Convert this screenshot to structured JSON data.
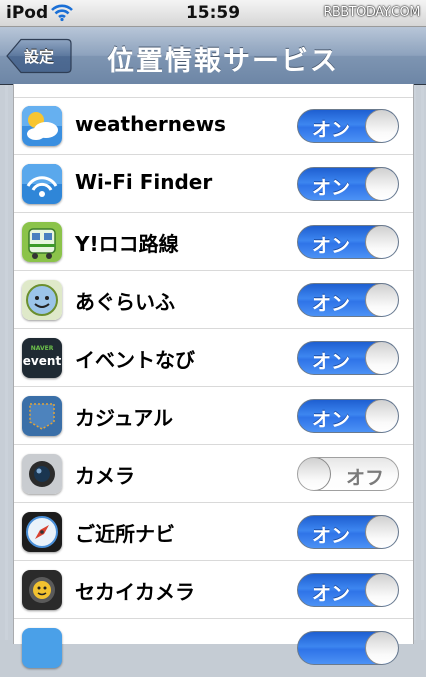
{
  "status": {
    "carrier": "iPod",
    "time": "15:59",
    "watermark": "RBBTODAY.COM"
  },
  "nav": {
    "back_label": "設定",
    "title": "位置情報サービス"
  },
  "apps": [
    {
      "name": "weathernews",
      "state": "オン",
      "on": true,
      "icon": "weathernews-icon"
    },
    {
      "name": "Wi-Fi Finder",
      "state": "オン",
      "on": true,
      "icon": "wifi-finder-icon"
    },
    {
      "name": "Y!ロコ路線",
      "state": "オン",
      "on": true,
      "icon": "train-icon"
    },
    {
      "name": "あぐらいふ",
      "state": "オン",
      "on": true,
      "icon": "face-icon"
    },
    {
      "name": "イベントなび",
      "state": "オン",
      "on": true,
      "icon": "naver-event-icon",
      "icon_text_small": "NAVER",
      "icon_text": "event"
    },
    {
      "name": "カジュアル",
      "state": "オン",
      "on": true,
      "icon": "denim-pocket-icon"
    },
    {
      "name": "カメラ",
      "state": "オフ",
      "on": false,
      "icon": "camera-icon"
    },
    {
      "name": "ご近所ナビ",
      "state": "オン",
      "on": true,
      "icon": "compass-icon"
    },
    {
      "name": "セカイカメラ",
      "state": "オン",
      "on": true,
      "icon": "sekai-camera-icon"
    }
  ]
}
